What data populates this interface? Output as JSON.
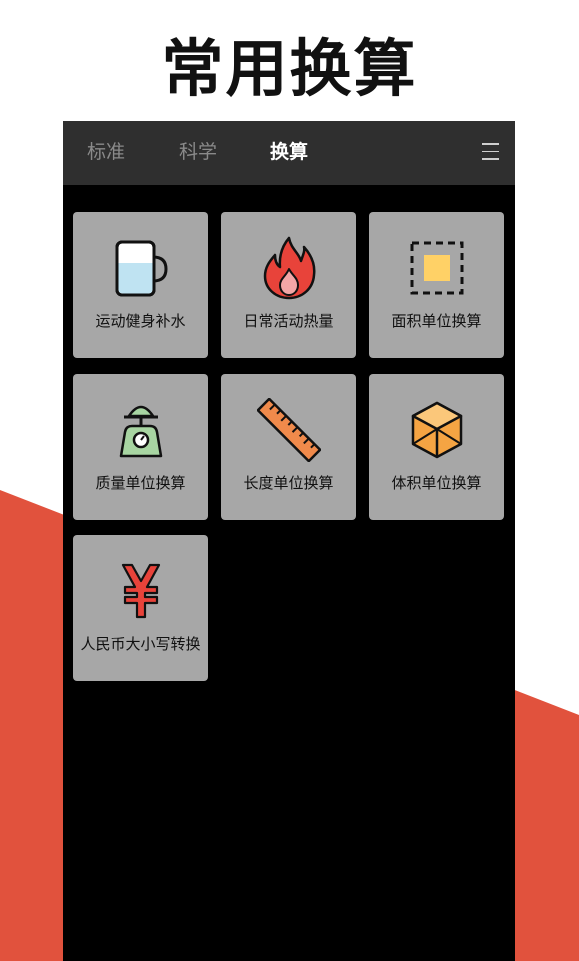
{
  "hero": {
    "title": "常用换算"
  },
  "topbar": {
    "tabs": [
      {
        "label": "标准",
        "active": false
      },
      {
        "label": "科学",
        "active": false
      },
      {
        "label": "换算",
        "active": true
      }
    ],
    "menu_icon": "hamburger-menu-icon"
  },
  "tools": [
    {
      "label": "运动健身补水",
      "icon": "water-cup-icon"
    },
    {
      "label": "日常活动热量",
      "icon": "flame-icon"
    },
    {
      "label": "面积单位换算",
      "icon": "area-square-icon"
    },
    {
      "label": "质量单位换算",
      "icon": "kitchen-scale-icon"
    },
    {
      "label": "长度单位换算",
      "icon": "ruler-icon"
    },
    {
      "label": "体积单位换算",
      "icon": "cube-icon"
    },
    {
      "label": "人民币大小写转换",
      "icon": "yuan-icon"
    }
  ],
  "colors": {
    "accent": "#e1523d",
    "card": "#a7a7a7",
    "topbar": "#2f2f2f"
  }
}
